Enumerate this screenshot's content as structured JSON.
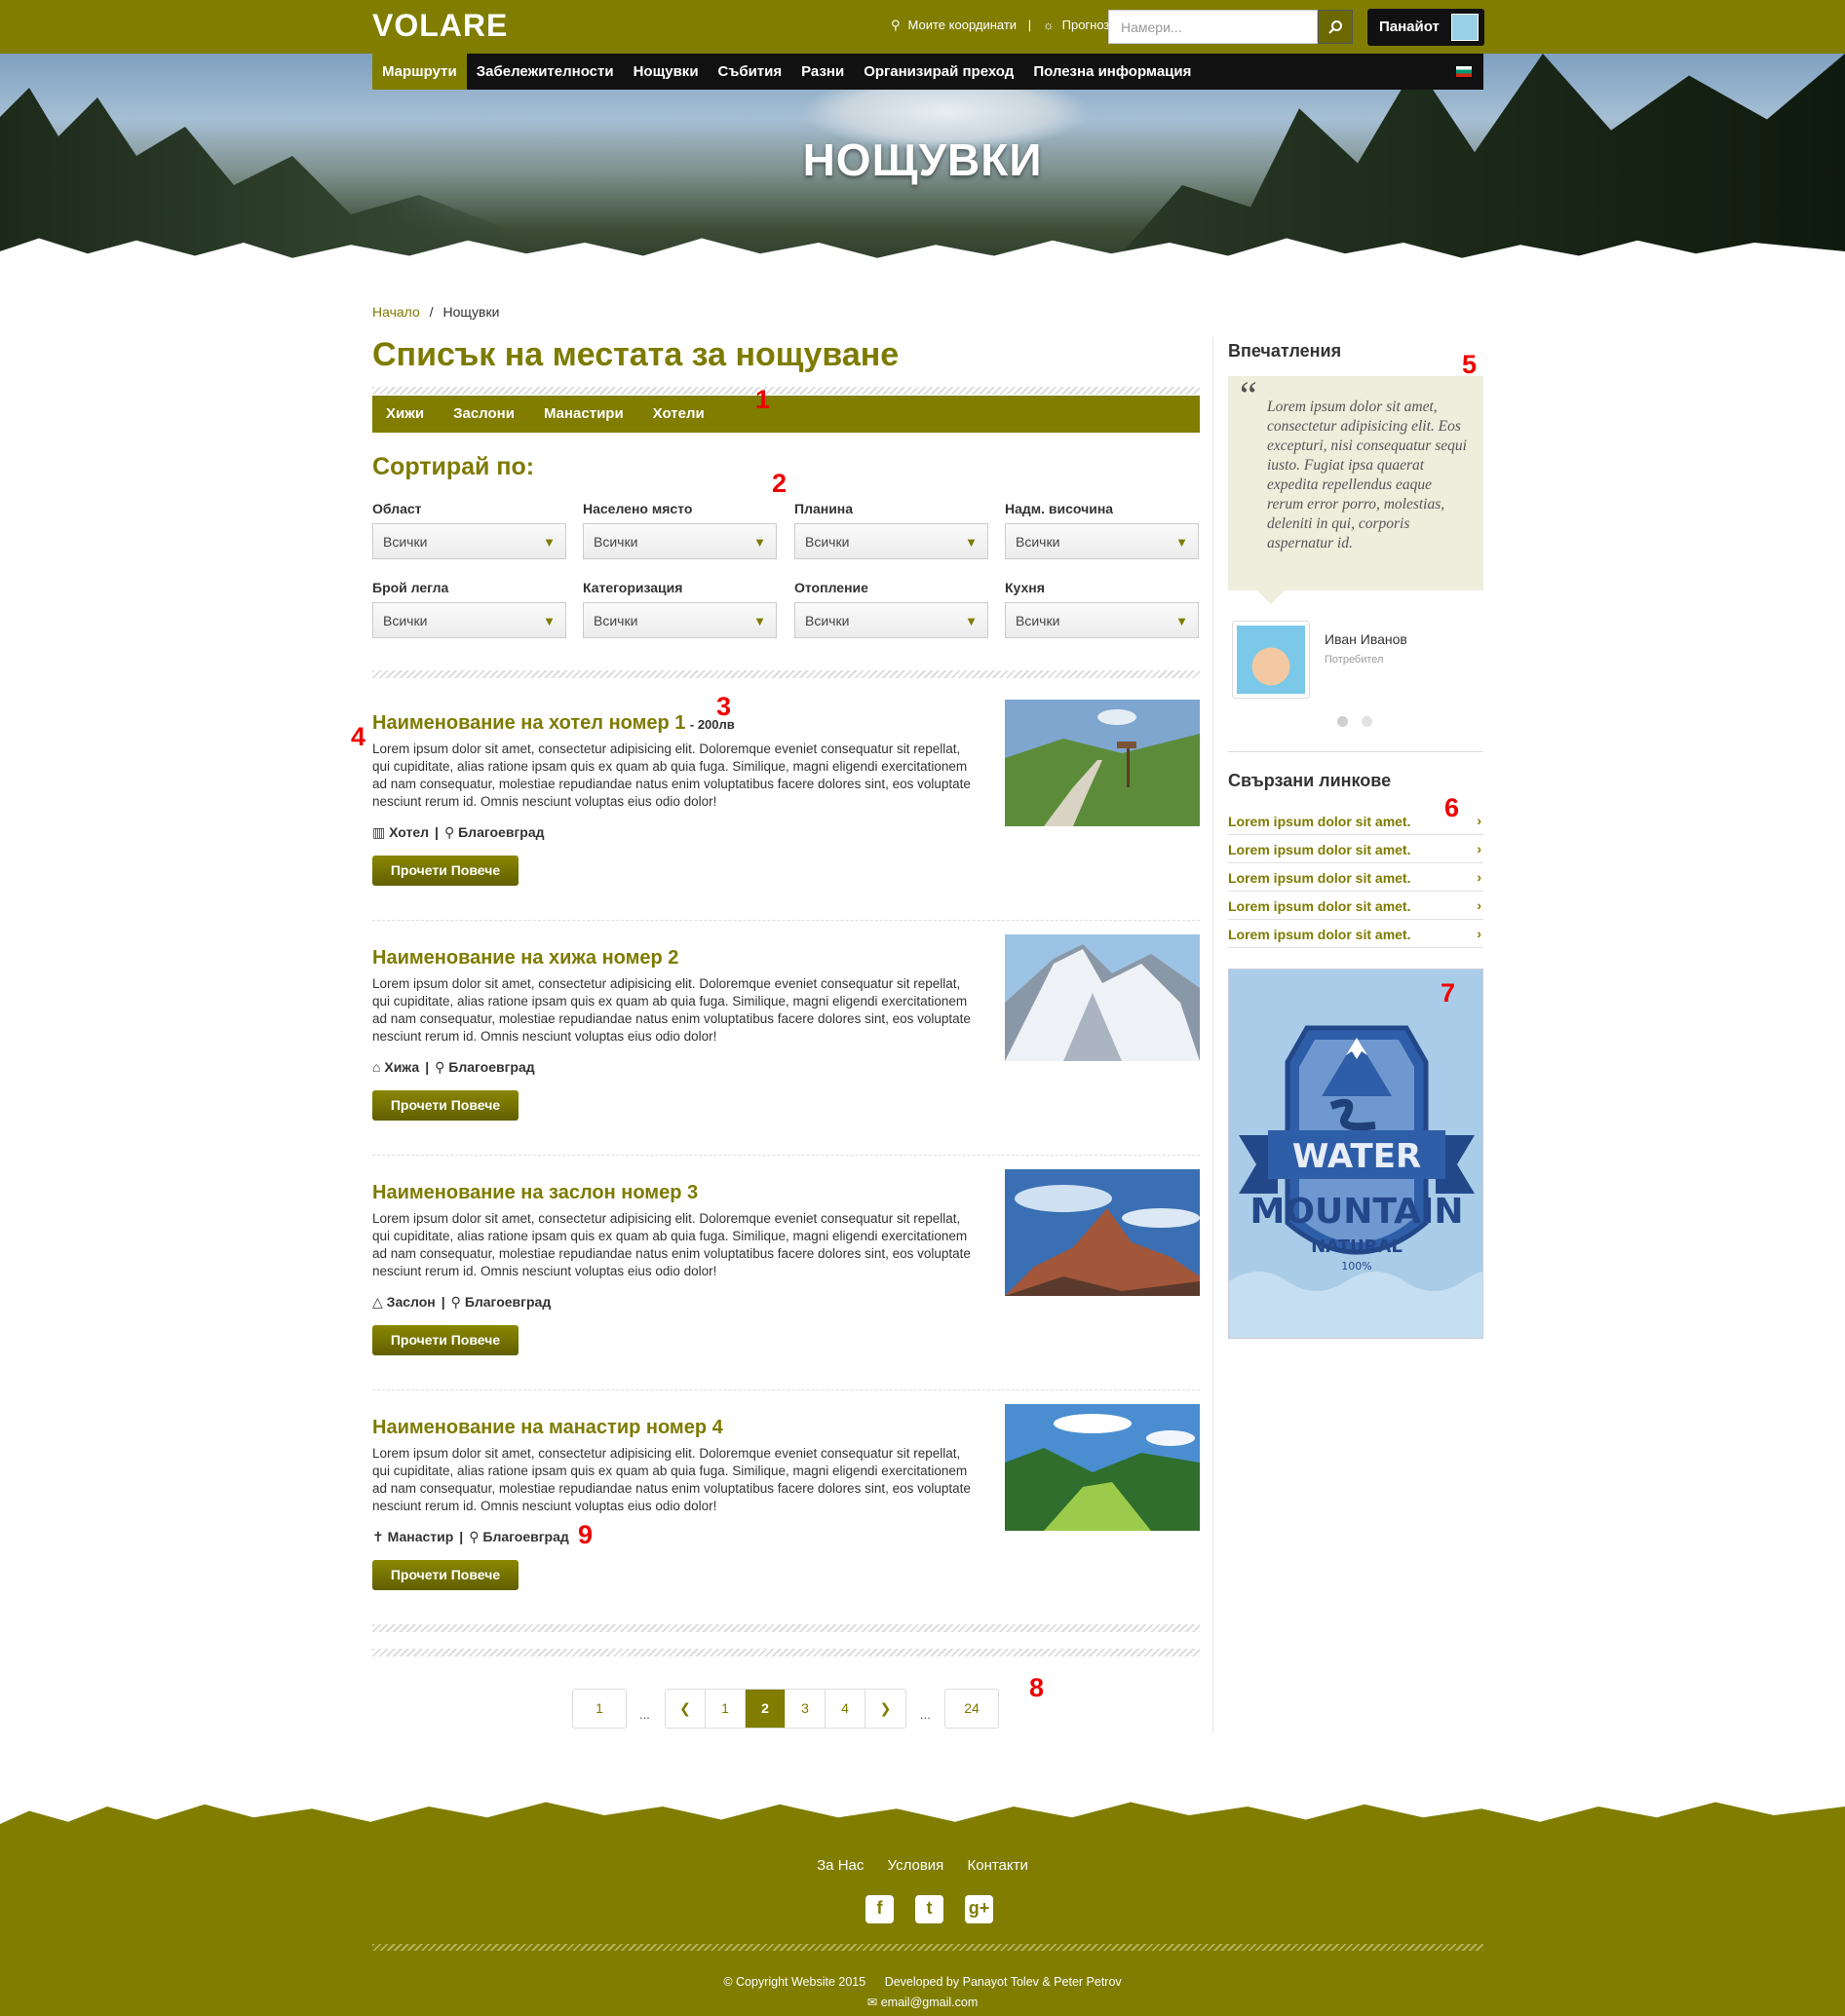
{
  "header": {
    "logo": "VOLARE",
    "my_coords": "Моите координати",
    "divider": "|",
    "forecast": "Прогноза",
    "search_placeholder": "Намери...",
    "user_name": "Панайот"
  },
  "nav": {
    "items": [
      {
        "label": "Маршрути",
        "active": true
      },
      {
        "label": "Забележителности",
        "active": false
      },
      {
        "label": "Нощувки",
        "active": false
      },
      {
        "label": "Събития",
        "active": false
      },
      {
        "label": "Разни",
        "active": false
      },
      {
        "label": "Организирай преход",
        "active": false
      },
      {
        "label": "Полезна информация",
        "active": false
      }
    ]
  },
  "hero": {
    "title": "НОЩУВКИ"
  },
  "breadcrumb": {
    "home": "Начало",
    "sep": "/",
    "current": "Нощувки"
  },
  "page_title": "Списък на местата за нощуване",
  "subnav": [
    "Хижи",
    "Заслони",
    "Манастири",
    "Хотели"
  ],
  "sort": {
    "title": "Сортирай по:",
    "filters": [
      {
        "label": "Област",
        "value": "Всички"
      },
      {
        "label": "Населено място",
        "value": "Всички"
      },
      {
        "label": "Планина",
        "value": "Всички"
      },
      {
        "label": "Надм. височина",
        "value": "Всички"
      },
      {
        "label": "Брой легла",
        "value": "Всички"
      },
      {
        "label": "Категоризация",
        "value": "Всички"
      },
      {
        "label": "Отопление",
        "value": "Всички"
      },
      {
        "label": "Кухня",
        "value": "Всички"
      }
    ]
  },
  "listings": [
    {
      "title": "Наименование на хотел номер 1",
      "price": "- 200лв",
      "desc": "Lorem ipsum dolor sit amet, consectetur adipisicing elit. Doloremque eveniet consequatur sit repellat, qui cupiditate, alias ratione ipsam quis ex quam ab quia fuga. Similique, magni eligendi exercitationem ad nam consequatur, molestiae repudiandae natus enim voluptatibus facere dolores sint, eos voluptate nesciunt rerum id. Omnis nesciunt voluptas eius odio dolor!",
      "type": "Хотел",
      "type_icon": "building-icon",
      "location": "Благоевград",
      "button": "Прочети Повече"
    },
    {
      "title": "Наименование на хижа номер 2",
      "price": "",
      "desc": "Lorem ipsum dolor sit amet, consectetur adipisicing elit. Doloremque eveniet consequatur sit repellat, qui cupiditate, alias ratione ipsam quis ex quam ab quia fuga. Similique, magni eligendi exercitationem ad nam consequatur, molestiae repudiandae natus enim voluptatibus facere dolores sint, eos voluptate nesciunt rerum id. Omnis nesciunt voluptas eius odio dolor!",
      "type": "Хижа",
      "type_icon": "home-icon",
      "location": "Благоевград",
      "button": "Прочети Повече"
    },
    {
      "title": "Наименование на заслон номер 3",
      "price": "",
      "desc": "Lorem ipsum dolor sit amet, consectetur adipisicing elit. Doloremque eveniet consequatur sit repellat, qui cupiditate, alias ratione ipsam quis ex quam ab quia fuga. Similique, magni eligendi exercitationem ad nam consequatur, molestiae repudiandae natus enim voluptatibus facere dolores sint, eos voluptate nesciunt rerum id. Omnis nesciunt voluptas eius odio dolor!",
      "type": "Заслон",
      "type_icon": "tent-icon",
      "location": "Благоевград",
      "button": "Прочети Повече"
    },
    {
      "title": "Наименование на манастир номер 4",
      "price": "",
      "desc": "Lorem ipsum dolor sit amet, consectetur adipisicing elit. Doloremque eveniet consequatur sit repellat, qui cupiditate, alias ratione ipsam quis ex quam ab quia fuga. Similique, magni eligendi exercitationem ad nam consequatur, molestiae repudiandae natus enim voluptatibus facere dolores sint, eos voluptate nesciunt rerum id. Omnis nesciunt voluptas eius odio dolor!",
      "type": "Манастир",
      "type_icon": "cross-icon",
      "location": "Благоевград",
      "button": "Прочети Повече"
    }
  ],
  "pagination": {
    "first": "1",
    "ellipsis": "...",
    "pages": [
      "1",
      "2",
      "3",
      "4"
    ],
    "active": "2",
    "last": "24"
  },
  "sidebar": {
    "testimonials_title": "Впечатления",
    "quote": "Lorem ipsum dolor sit amet, consectetur adipisicing elit. Eos excepturi, nisi consequatur sequi iusto. Fugiat ipsa quaerat expedita repellendus eaque rerum error porro, molestias, deleniti in qui, corporis aspernatur id.",
    "author": "Иван Иванов",
    "role": "Потребител",
    "links_title": "Свързани линкове",
    "links": [
      "Lorem ipsum dolor sit amet.",
      "Lorem ipsum dolor sit amet.",
      "Lorem ipsum dolor sit amet.",
      "Lorem ipsum dolor sit amet.",
      "Lorem ipsum dolor sit amet."
    ],
    "ad": {
      "line1": "WATER",
      "line2": "MOUNTAIN",
      "line3": "NATURAL",
      "line4": "100%"
    }
  },
  "footer": {
    "links": [
      "За Нас",
      "Условия",
      "Контакти"
    ],
    "social": [
      "facebook-icon",
      "twitter-icon",
      "google-plus-icon"
    ],
    "copyright": "© Copyright Website 2015",
    "developed": "Developed by Panayot Tolev & Peter Petrov",
    "email": "email@gmail.com"
  },
  "annotations": [
    "1",
    "2",
    "3",
    "4",
    "5",
    "6",
    "7",
    "8",
    "9"
  ],
  "colors": {
    "accent": "#807d00",
    "text": "#333333",
    "annotation": "#ee0000"
  }
}
